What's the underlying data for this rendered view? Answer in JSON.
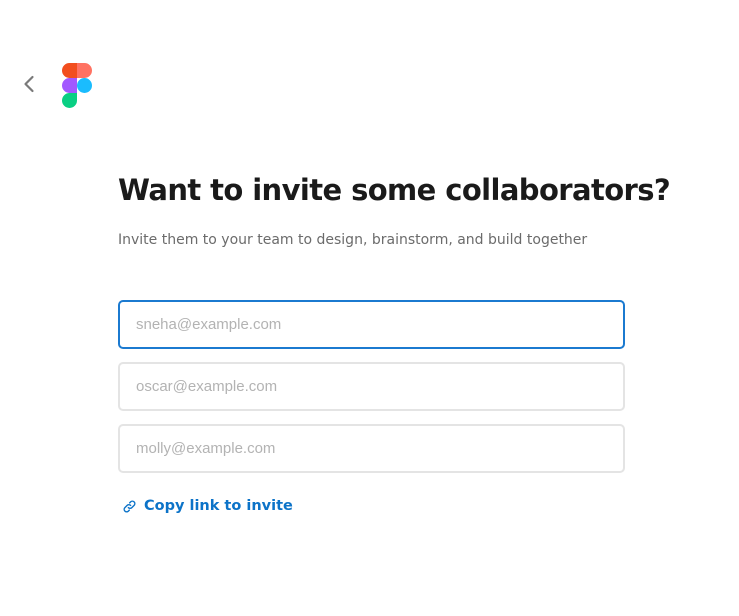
{
  "header": {
    "back_icon": "chevron-left-icon",
    "logo_icon": "figma-logo-icon",
    "logo_colors": [
      "#f24e1e",
      "#ff7262",
      "#a259ff",
      "#1abcfe",
      "#0acf83"
    ]
  },
  "invite": {
    "title": "Want to invite some collaborators?",
    "subtitle": "Invite them to your team to design, brainstorm, and build together",
    "email_placeholders": [
      "sneha@example.com",
      "oscar@example.com",
      "molly@example.com"
    ],
    "copy_link_label": "Copy link to invite",
    "copy_link_icon": "link-icon"
  },
  "colors": {
    "accent": "#0c73c8",
    "focus_border": "#1b7ad0",
    "input_border": "#e4e4e4"
  }
}
